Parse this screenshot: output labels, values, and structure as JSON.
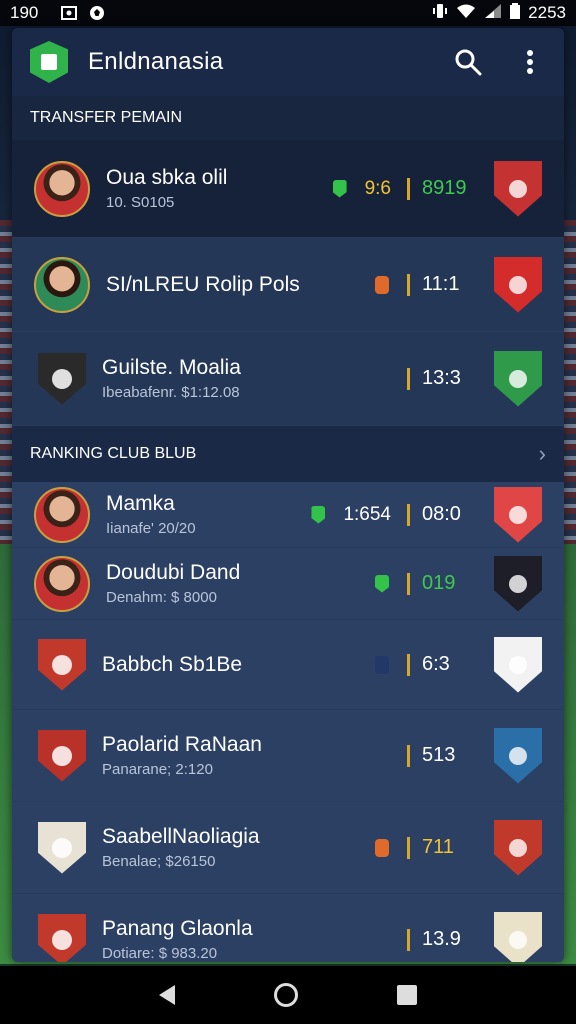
{
  "status_bar": {
    "time": "190",
    "clock": "2253"
  },
  "app": {
    "title": "Enldnanasia"
  },
  "transfer_section": {
    "title": "TRANSFER PEMAIN",
    "rows": [
      {
        "name": "Oua sbka olil",
        "sub": "10. S0105",
        "pretext": "9:6",
        "pretext_color": "#f2c230",
        "indicator": "green",
        "score": "8919",
        "score_color": "#3ec94f",
        "crest_color": "#c43232",
        "style": "dark",
        "left": "avatar"
      },
      {
        "name": "SI/nLREU Rolip Pols",
        "sub": "",
        "pretext": "",
        "pretext_color": "#ffffff",
        "indicator": "orange",
        "score": "11:1",
        "score_color": "#ffffff",
        "crest_color": "#d42b2b",
        "style": "mid",
        "left": "avatar-alt"
      },
      {
        "name": "Guilste. Moalia",
        "sub": "Ibeabafenr. $1:12.08",
        "pretext": "",
        "pretext_color": "#ffffff",
        "indicator": "",
        "score": "13:3",
        "score_color": "#ffffff",
        "crest_color": "#2e9a4a",
        "style": "mid",
        "left": "crest",
        "left_color": "#2a2a2a"
      }
    ]
  },
  "ranking_section": {
    "title": "RANKING CLUB BLUB",
    "rows": [
      {
        "name": "Mamka",
        "sub": "Iianafe' 20/20",
        "pretext": "1:654",
        "pretext_color": "#ffffff",
        "indicator": "green",
        "score": "08:0",
        "score_color": "#ffffff",
        "crest_color": "#e04646",
        "style": "light",
        "left": "avatar"
      },
      {
        "name": "Doudubi Dand",
        "sub": "Denahm: $ 8000",
        "pretext": "",
        "pretext_color": "#ffffff",
        "indicator": "green",
        "score": "019",
        "score_color": "#3ec94f",
        "crest_color": "#1e1e28",
        "style": "light",
        "left": "avatar"
      },
      {
        "name": "Babbch Sb1Be",
        "sub": "",
        "pretext": "",
        "pretext_color": "#ffffff",
        "indicator": "navy",
        "score": "6:3",
        "score_color": "#ffffff",
        "crest_color": "#f2f2f2",
        "style": "light",
        "left": "crest",
        "left_color": "#c0392b"
      },
      {
        "name": "Paolarid RaNaan",
        "sub": "Panarane; 2:120",
        "pretext": "",
        "pretext_color": "#ffffff",
        "indicator": "",
        "score": "513",
        "score_color": "#ffffff",
        "crest_color": "#2a6fa8",
        "style": "light",
        "left": "crest",
        "left_color": "#b8322a"
      },
      {
        "name": "SaabellNaoliagia",
        "sub": "Benalae; $26150",
        "pretext": "",
        "pretext_color": "#ffffff",
        "indicator": "orange",
        "score": "711",
        "score_color": "#f2c230",
        "crest_color": "#c0392b",
        "style": "light",
        "left": "crest",
        "left_color": "#e7e2d4"
      },
      {
        "name": "Panang Glaonla",
        "sub": "Dotiare: $ 983.20",
        "pretext": "",
        "pretext_color": "#ffffff",
        "indicator": "",
        "score": "13.9",
        "score_color": "#ffffff",
        "crest_color": "#e9e2c8",
        "style": "light",
        "left": "crest",
        "left_color": "#c0392b"
      }
    ]
  }
}
